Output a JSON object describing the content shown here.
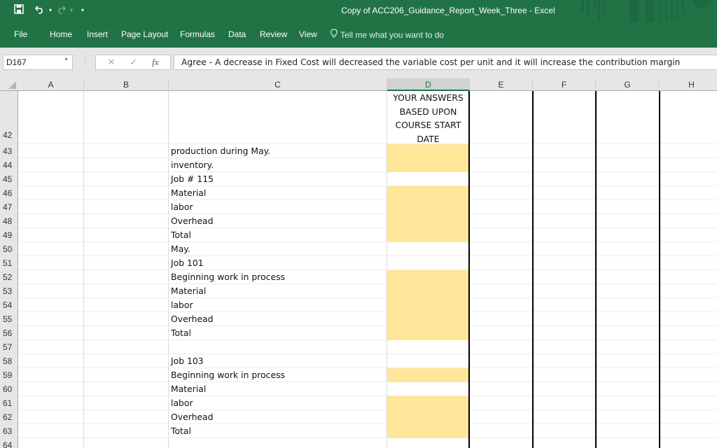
{
  "window": {
    "title": "Copy of ACC206_Guidance_Report_Week_Three  -  Excel",
    "quick_access": {
      "save_icon": "save-icon",
      "undo_icon": "undo-icon",
      "redo_icon": "redo-icon",
      "customize_icon": "customize-qat-icon"
    }
  },
  "ribbon": {
    "tabs": [
      "File",
      "Home",
      "Insert",
      "Page Layout",
      "Formulas",
      "Data",
      "Review",
      "View"
    ],
    "tell_me": "Tell me what you want to do"
  },
  "formula_bar": {
    "name_box": "D167",
    "cancel_glyph": "✕",
    "enter_glyph": "✓",
    "fx_label": "fx",
    "formula": "Agree - A decrease in Fixed Cost will decreased the variable cost per unit and it will increase the contribution margin"
  },
  "columns": [
    "A",
    "B",
    "C",
    "D",
    "E",
    "F",
    "G",
    "H"
  ],
  "selected_column": "D",
  "header_row": {
    "row_number": "42",
    "d_lines": [
      "YOUR ANSWERS",
      "BASED UPON",
      "COURSE START",
      "DATE"
    ]
  },
  "rows": [
    {
      "num": "43",
      "c": "production during May.",
      "d_fill": true
    },
    {
      "num": "44",
      "c": "inventory.",
      "d_fill": true
    },
    {
      "num": "45",
      "c": "Job # 115",
      "d_fill": false
    },
    {
      "num": "46",
      "c": "Material",
      "d_fill": true
    },
    {
      "num": "47",
      "c": "labor",
      "d_fill": true
    },
    {
      "num": "48",
      "c": "Overhead",
      "d_fill": true
    },
    {
      "num": "49",
      "c": "Total",
      "d_fill": true
    },
    {
      "num": "50",
      "c": "May.",
      "d_fill": false
    },
    {
      "num": "51",
      "c": "Job 101",
      "d_fill": false
    },
    {
      "num": "52",
      "c": "Beginning work in process",
      "d_fill": true
    },
    {
      "num": "53",
      "c": "Material",
      "d_fill": true
    },
    {
      "num": "54",
      "c": "labor",
      "d_fill": true
    },
    {
      "num": "55",
      "c": "Overhead",
      "d_fill": true
    },
    {
      "num": "56",
      "c": "Total",
      "d_fill": true
    },
    {
      "num": "57",
      "c": "",
      "d_fill": false
    },
    {
      "num": "58",
      "c": "Job 103",
      "d_fill": false
    },
    {
      "num": "59",
      "c": "Beginning work in process",
      "d_fill": true
    },
    {
      "num": "60",
      "c": "Material",
      "d_fill": false
    },
    {
      "num": "61",
      "c": "labor",
      "d_fill": true
    },
    {
      "num": "62",
      "c": "Overhead",
      "d_fill": true
    },
    {
      "num": "63",
      "c": "Total",
      "d_fill": true
    },
    {
      "num": "64",
      "c": "",
      "d_fill": false
    }
  ],
  "colors": {
    "excel_green": "#217346",
    "answer_fill": "#ffe699"
  }
}
